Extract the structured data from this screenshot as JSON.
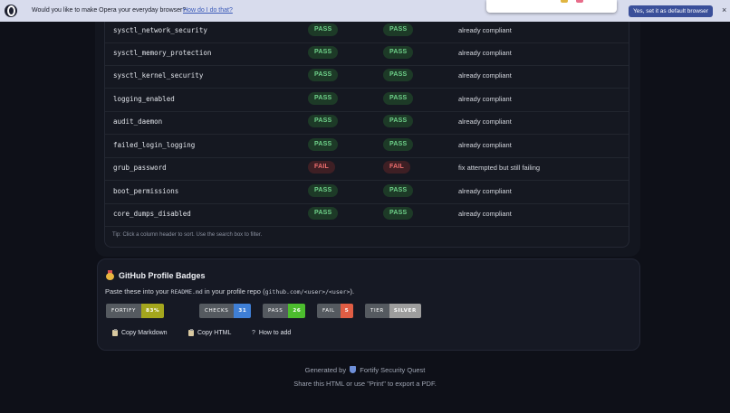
{
  "opera_bar": {
    "message": "Would you like to make Opera your everyday browser?",
    "link": "How do I do that?",
    "button": "Yes, set it as default browser",
    "close": "×"
  },
  "checks": [
    {
      "name": "sysctl_network_security",
      "before": "PASS",
      "after": "PASS",
      "note": "already compliant"
    },
    {
      "name": "sysctl_memory_protection",
      "before": "PASS",
      "after": "PASS",
      "note": "already compliant"
    },
    {
      "name": "sysctl_kernel_security",
      "before": "PASS",
      "after": "PASS",
      "note": "already compliant"
    },
    {
      "name": "logging_enabled",
      "before": "PASS",
      "after": "PASS",
      "note": "already compliant"
    },
    {
      "name": "audit_daemon",
      "before": "PASS",
      "after": "PASS",
      "note": "already compliant"
    },
    {
      "name": "failed_login_logging",
      "before": "PASS",
      "after": "PASS",
      "note": "already compliant"
    },
    {
      "name": "grub_password",
      "before": "FAIL",
      "after": "FAIL",
      "note": "fix attempted but still failing"
    },
    {
      "name": "boot_permissions",
      "before": "PASS",
      "after": "PASS",
      "note": "already compliant"
    },
    {
      "name": "core_dumps_disabled",
      "before": "PASS",
      "after": "PASS",
      "note": "already compliant"
    }
  ],
  "tip": "Tip: Click a column header to sort. Use the search box to filter.",
  "badges": {
    "title": "GitHub Profile Badges",
    "desc_before": "Paste these into your ",
    "desc_code1": "README.md",
    "desc_mid": " in your profile repo (",
    "desc_code2": "github.com/<user>/<user>",
    "desc_after": ").",
    "items": [
      {
        "label": "FORTIFY SCORE",
        "value": "83%",
        "color": "#a4a61d"
      },
      {
        "label": "CHECKS",
        "value": "31",
        "color": "#3f7fd6"
      },
      {
        "label": "PASS",
        "value": "26",
        "color": "#4cbd2e"
      },
      {
        "label": "FAIL",
        "value": "5",
        "color": "#e05d44"
      },
      {
        "label": "TIER",
        "value": "SILVER",
        "color": "#9d9d9d"
      }
    ],
    "copy_markdown": "Copy Markdown",
    "copy_html": "Copy HTML",
    "how_to_add": "How to add"
  },
  "footer": {
    "generated_by": "Generated by",
    "brand": "Fortify Security Quest",
    "share": "Share this HTML or use \"Print\" to export a PDF."
  },
  "icons": {
    "opera": "opera-logo-icon",
    "medal": "medal-icon",
    "clipboard": "clipboard-icon",
    "help": "question-icon",
    "shield": "shield-icon"
  }
}
